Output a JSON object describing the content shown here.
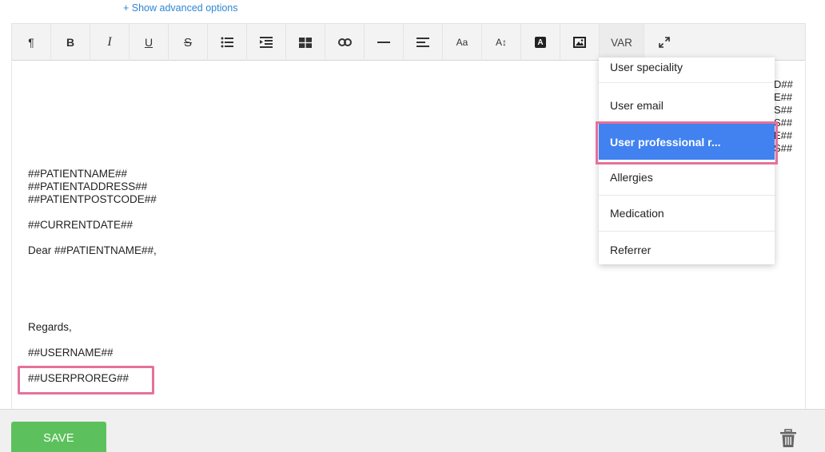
{
  "advanced_link": "+ Show advanced options",
  "toolbar": {
    "paragraph_icon": "¶",
    "bold": "B",
    "italic": "I",
    "underline": "U",
    "strike": "S",
    "font_family": "Aa",
    "font_size": "A↕",
    "text_color": "A",
    "var_label": "VAR"
  },
  "editor": {
    "right_fragments": [
      "D##",
      "E##",
      "S##",
      "S##",
      "E##",
      "S##"
    ],
    "lines": {
      "patient_name": "##PATIENTNAME##",
      "patient_address": "##PATIENTADDRESS##",
      "patient_postcode": "##PATIENTPOSTCODE##",
      "current_date": "##CURRENTDATE##",
      "greeting": "Dear ##PATIENTNAME##,",
      "regards": "Regards,",
      "username": "##USERNAME##",
      "user_pro_reg": "##USERPROREG##"
    }
  },
  "var_dropdown": {
    "items": [
      {
        "label": "User speciality"
      },
      {
        "label": "User email"
      },
      {
        "label": "User professional r..."
      },
      {
        "label": "Allergies"
      },
      {
        "label": "Medication"
      },
      {
        "label": "Referrer"
      }
    ],
    "selected_index": 2
  },
  "footer": {
    "save_label": "SAVE",
    "delete_icon": "trash-icon"
  },
  "colors": {
    "accent_blue": "#4182f0",
    "highlight_pink": "#e5719b",
    "save_green": "#5cc15c",
    "link_blue": "#2f86d4"
  }
}
